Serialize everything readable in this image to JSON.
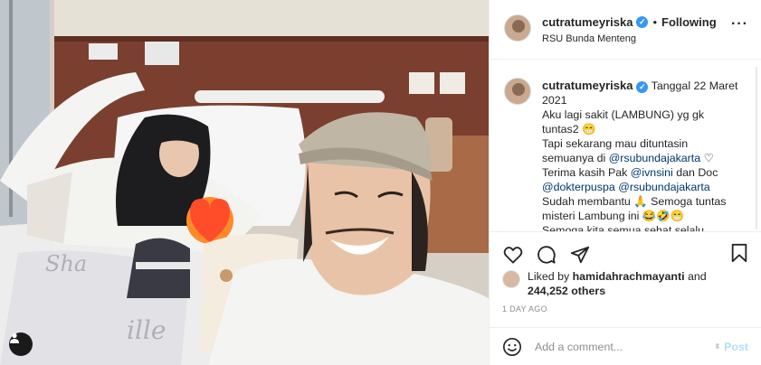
{
  "header": {
    "username": "cutratumeyriska",
    "separator": "•",
    "follow_status": "Following",
    "location": "RSU Bunda Menteng",
    "more_icon": "more-horizontal-icon"
  },
  "caption": {
    "username": "cutratumeyriska",
    "line1": " Tanggal 22 Maret 2021",
    "line2": "Aku lagi sakit (LAMBUNG) yg gk tuntas2 😁",
    "line3_pre": "Tapi sekarang mau dituntasin semuanya di ",
    "line3_mention": "@rsubundajakarta",
    "line3_post": " ♡",
    "line4_pre": "Terima kasih Pak ",
    "line4_mention1": "@ivnsini",
    "line4_mid": " dan Doc ",
    "line4_mention2": "@dokterpuspa",
    "line4_mention3": "@rsubundajakarta",
    "line5": "Sudah membantu 🙏 Semoga tuntas misteri Lambung ini 😂🤣😁",
    "line6": "Semoga kita semua sehat selalu"
  },
  "actions": {
    "like_icon": "heart-icon",
    "comment_icon": "comment-icon",
    "share_icon": "send-icon",
    "save_icon": "bookmark-icon"
  },
  "likes": {
    "prefix": "Liked by ",
    "user": "hamidahrachmayanti",
    "and": " and",
    "count": "244,252 others"
  },
  "timestamp": "1 DAY AGO",
  "comment": {
    "placeholder": "Add a comment...",
    "post_label": "Post",
    "emoji_icon": "emoji-smile-icon"
  },
  "colors": {
    "link": "#00376b",
    "verified": "#3897f0",
    "post_disabled": "#b2dffc",
    "muted": "#8e8e8e"
  }
}
